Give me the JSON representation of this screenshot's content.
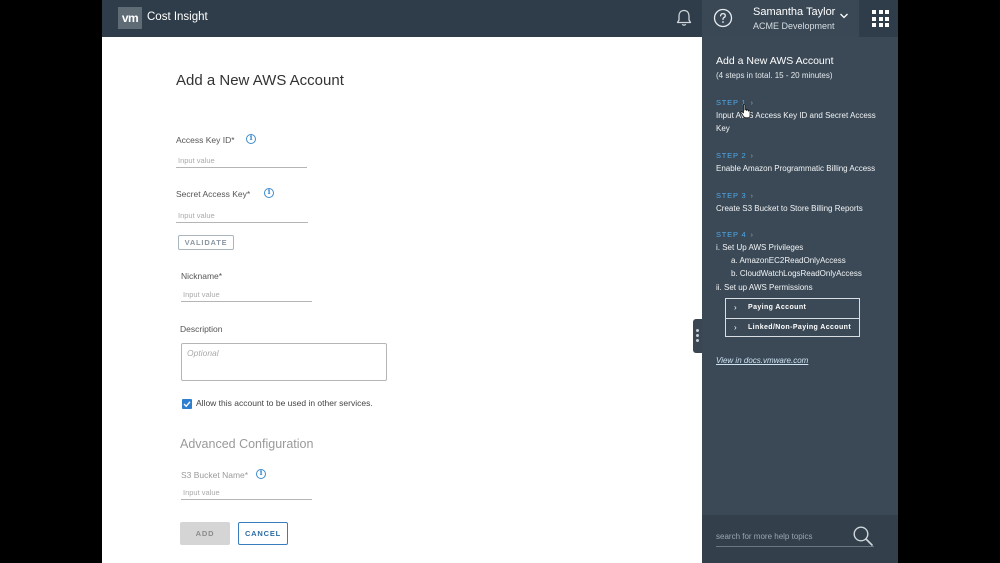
{
  "header": {
    "logo_text": "vm",
    "app_title": "Cost Insight",
    "user_name": "Samantha Taylor",
    "user_org": "ACME Development"
  },
  "form": {
    "heading": "Add a New AWS Account",
    "access_key_label": "Access Key ID*",
    "access_key_placeholder": "Input value",
    "secret_key_label": "Secret Access Key*",
    "secret_key_placeholder": "Input value",
    "validate_label": "VALIDATE",
    "nickname_label": "Nickname*",
    "nickname_placeholder": "Input value",
    "description_label": "Description",
    "description_placeholder": "Optional",
    "allow_label": "Allow this account to be used in other services.",
    "allow_checked": true,
    "advanced_title": "Advanced Configuration",
    "s3_label": "S3 Bucket Name*",
    "s3_placeholder": "Input value",
    "add_label": "ADD",
    "cancel_label": "CANCEL"
  },
  "help_panel": {
    "title": "Add a New AWS Account",
    "subtitle": "(4 steps in total. 15 - 20 minutes)",
    "steps": [
      {
        "link": "STEP 1",
        "desc": "Input AWS Access Key ID and Secret Access Key"
      },
      {
        "link": "STEP 2",
        "desc": "Enable Amazon Programmatic Billing Access"
      },
      {
        "link": "STEP 3",
        "desc": "Create S3 Bucket to Store Billing Reports"
      },
      {
        "link": "STEP 4",
        "desc": ""
      }
    ],
    "step4_items": {
      "i": "i. Set Up AWS Privileges",
      "a": "a. AmazonEC2ReadOnlyAccess",
      "b": "b. CloudWatchLogsReadOnlyAccess",
      "ii": "ii. Set up AWS Permissions"
    },
    "paying_account": "Paying Account",
    "linked_account": "Linked/Non-Paying Account",
    "docs_link": "View in docs.vmware.com",
    "search_placeholder": "search for more help topics"
  },
  "colors": {
    "header_bg": "#2f3d4a",
    "panel_bg": "#3b4956",
    "link_blue": "#4ea8e8",
    "primary": "#2f7fd0"
  },
  "icons": [
    "vmware-logo",
    "bell-icon",
    "help-icon",
    "chevron-down-icon",
    "app-grid-icon",
    "info-icon",
    "checkmark-icon",
    "chevron-right-icon",
    "search-icon",
    "drag-handle-icon",
    "cursor-icon"
  ]
}
